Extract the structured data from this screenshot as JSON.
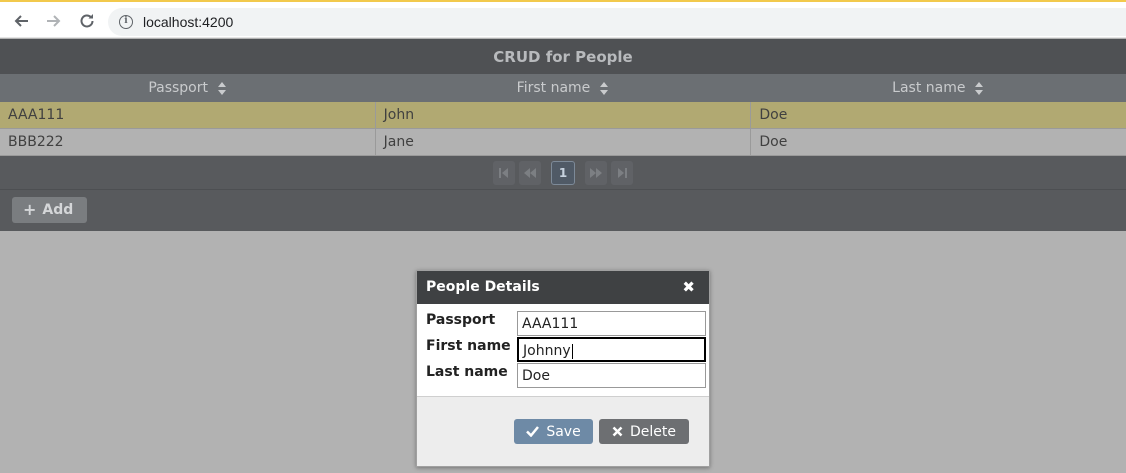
{
  "browser": {
    "url": "localhost:4200",
    "icons": [
      "back-icon",
      "forward-icon",
      "reload-icon",
      "info-icon"
    ]
  },
  "table": {
    "caption": "CRUD for People",
    "columns": [
      "Passport",
      "First name",
      "Last name"
    ],
    "rows": [
      [
        "AAA111",
        "John",
        "Doe"
      ],
      [
        "BBB222",
        "Jane",
        "Doe"
      ]
    ],
    "selected_row": 0,
    "paginator": {
      "current_page": "1"
    },
    "add_label": "Add"
  },
  "dialog": {
    "title": "People Details",
    "fields": [
      {
        "label": "Passport",
        "value": "AAA111"
      },
      {
        "label": "First name",
        "value": "Johnny"
      },
      {
        "label": "Last name",
        "value": "Doe"
      }
    ],
    "save_label": "Save",
    "delete_label": "Delete"
  },
  "colors": {
    "selected_row": "#b1a972",
    "primary_button": "#6e8aa6",
    "dialog_header": "#3f4143"
  }
}
